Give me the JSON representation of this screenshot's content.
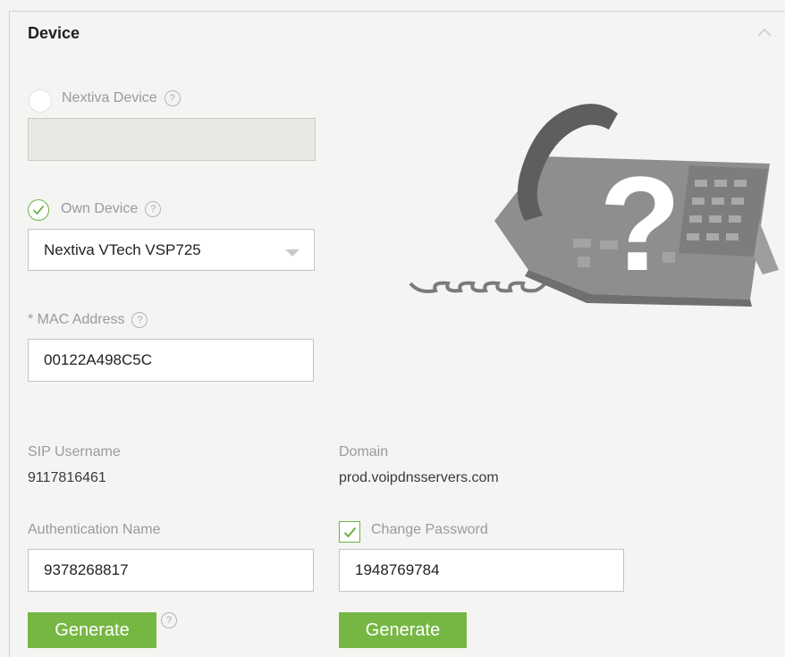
{
  "section": {
    "title": "Device",
    "collapse_icon": "chevron-up-icon"
  },
  "nextiva_device": {
    "label": "Nextiva Device",
    "help": "?",
    "selected": false,
    "value": ""
  },
  "own_device": {
    "label": "Own Device",
    "help": "?",
    "selected": true,
    "model": "Nextiva VTech VSP725"
  },
  "mac_address": {
    "label": "* MAC Address",
    "help": "?",
    "value": "00122A498C5C"
  },
  "sip_username": {
    "label": "SIP Username",
    "value": "9117816461"
  },
  "domain": {
    "label": "Domain",
    "value": "prod.voipdnsservers.com"
  },
  "authentication_name": {
    "label": "Authentication Name",
    "value": "9378268817",
    "generate_label": "Generate",
    "help": "?"
  },
  "change_password": {
    "label": "Change Password",
    "checked": true,
    "value": "1948769784",
    "generate_label": "Generate"
  },
  "colors": {
    "accent": "#76b743",
    "check": "#6bb244",
    "label": "#9a9a9a",
    "background": "#f4f4f3"
  },
  "image": {
    "icon": "unknown-phone-icon",
    "overlay_glyph": "?"
  }
}
